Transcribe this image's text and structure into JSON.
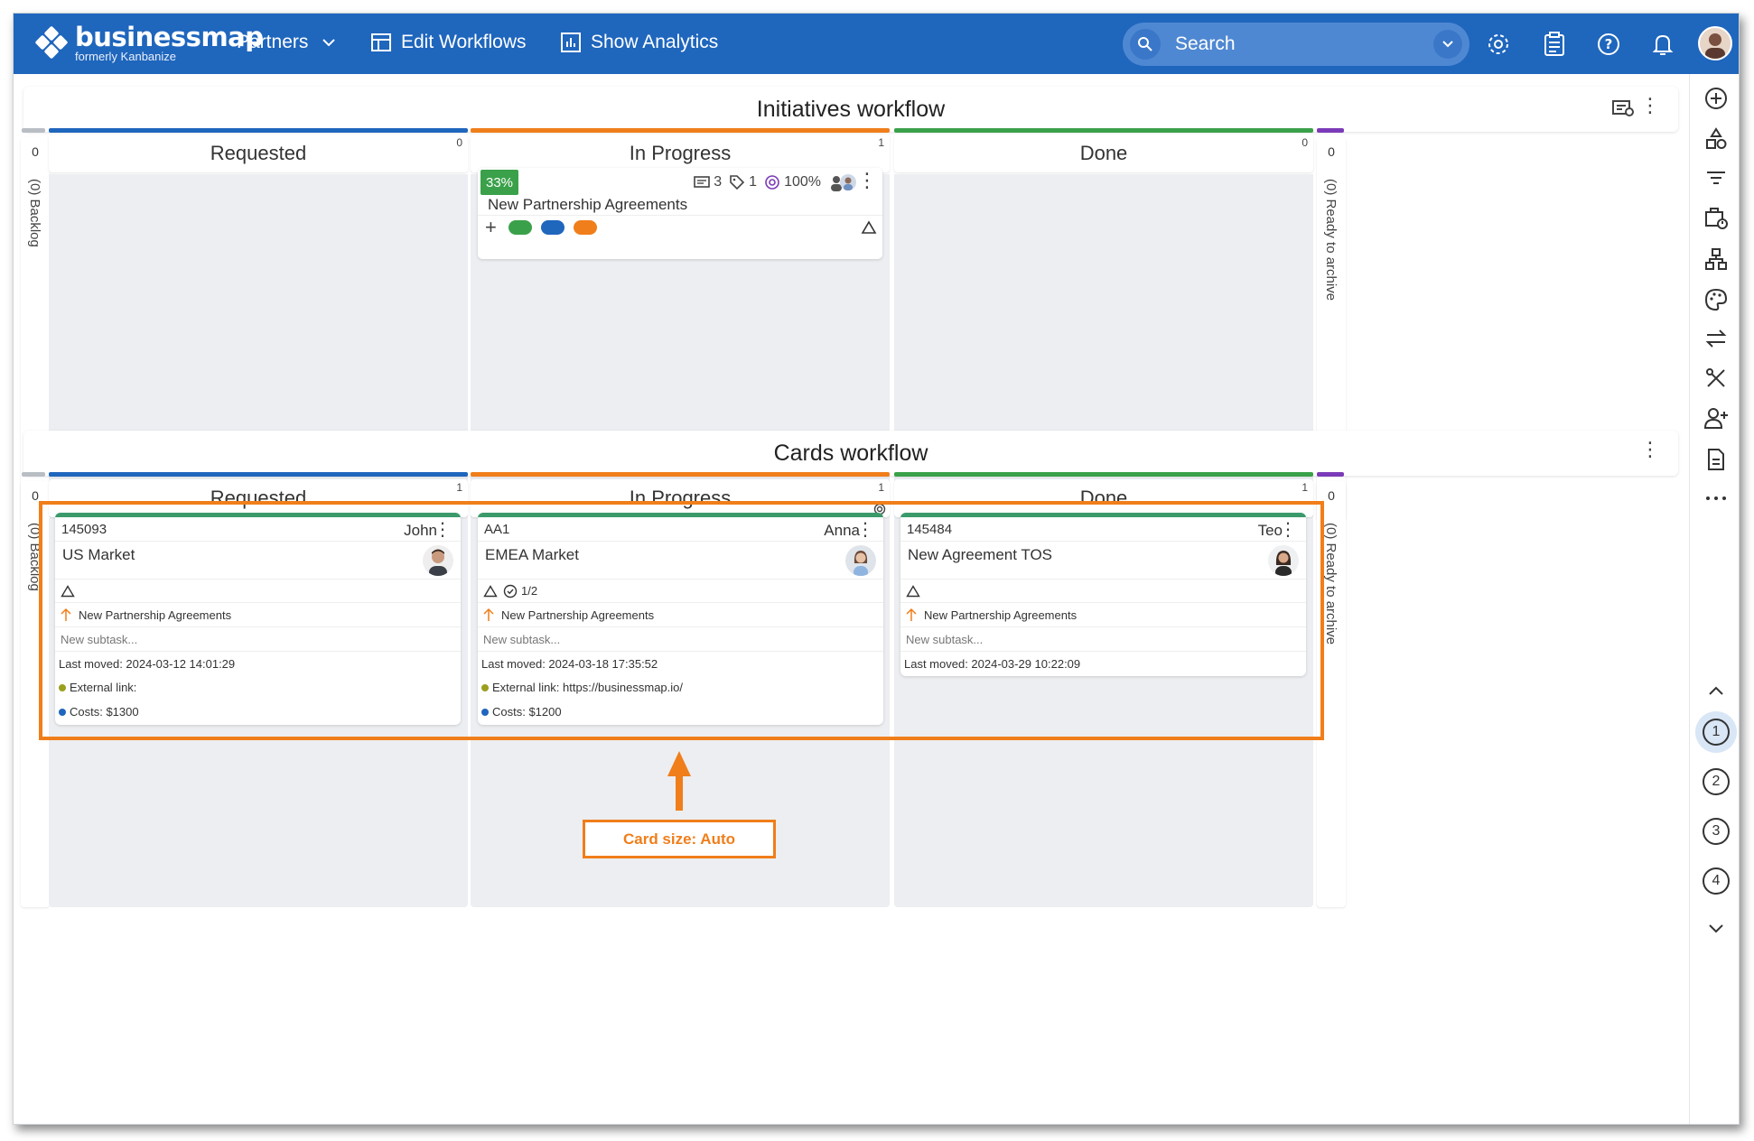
{
  "topbar": {
    "logo_name": "businessmap",
    "logo_sub": "formerly Kanbanize",
    "nav": [
      {
        "label": "Partners",
        "icon": "chevron-down-icon"
      },
      {
        "label": "Edit Workflows",
        "icon": "table-icon"
      },
      {
        "label": "Show Analytics",
        "icon": "chart-icon"
      }
    ],
    "search_placeholder": "Search",
    "icons": [
      "gear-icon",
      "clipboard-icon",
      "help-icon",
      "bell-icon",
      "user-avatar"
    ]
  },
  "initiatives": {
    "title": "Initiatives workflow",
    "left_side": {
      "zero": "0",
      "label": "(0) Backlog"
    },
    "right_side": {
      "zero": "0",
      "label": "(0) Ready to archive"
    },
    "columns": [
      {
        "name": "Requested",
        "count": "0",
        "color": "#1f66bd"
      },
      {
        "name": "In Progress",
        "count": "1",
        "color": "#f07e1a"
      },
      {
        "name": "Done",
        "count": "0",
        "color": "#3aa14a"
      }
    ],
    "card": {
      "progress": "33%",
      "comments": "3",
      "tags": "1",
      "target": "100%",
      "title": "New Partnership Agreements",
      "pill_colors": [
        "#3aa14a",
        "#1f66bd",
        "#f07e1a"
      ]
    }
  },
  "cards": {
    "title": "Cards workflow",
    "left_side": {
      "zero": "0",
      "label": "(0) Backlog"
    },
    "right_side": {
      "zero": "0",
      "label": "(0) Ready to archive"
    },
    "columns": [
      {
        "name": "Requested",
        "count": "1",
        "color": "#1f66bd"
      },
      {
        "name": "In Progress",
        "count": "1",
        "color": "#f07e1a"
      },
      {
        "name": "Done",
        "count": "1",
        "color": "#3aa14a"
      }
    ],
    "items": [
      {
        "id": "145093",
        "owner": "John",
        "title": "US Market",
        "parent": "New Partnership Agreements",
        "subtask_placeholder": "New subtask...",
        "last_moved": "Last moved: 2024-03-12 14:01:29",
        "external_link": "External link:",
        "costs": "Costs: $1300"
      },
      {
        "id": "AA1",
        "owner": "Anna",
        "title": "EMEA Market",
        "subtasks": "1/2",
        "parent": "New Partnership Agreements",
        "subtask_placeholder": "New subtask...",
        "last_moved": "Last moved: 2024-03-18 17:35:52",
        "external_link": "External link: https://businessmap.io/",
        "costs": "Costs: $1200"
      },
      {
        "id": "145484",
        "owner": "Teo",
        "title": "New Agreement TOS",
        "parent": "New Partnership Agreements",
        "subtask_placeholder": "New subtask...",
        "last_moved": "Last moved: 2024-03-29 10:22:09"
      }
    ]
  },
  "sidebar_lanes": [
    "1",
    "2",
    "3",
    "4"
  ],
  "annotation": {
    "label": "Card size: Auto",
    "color": "#f07e1a"
  }
}
